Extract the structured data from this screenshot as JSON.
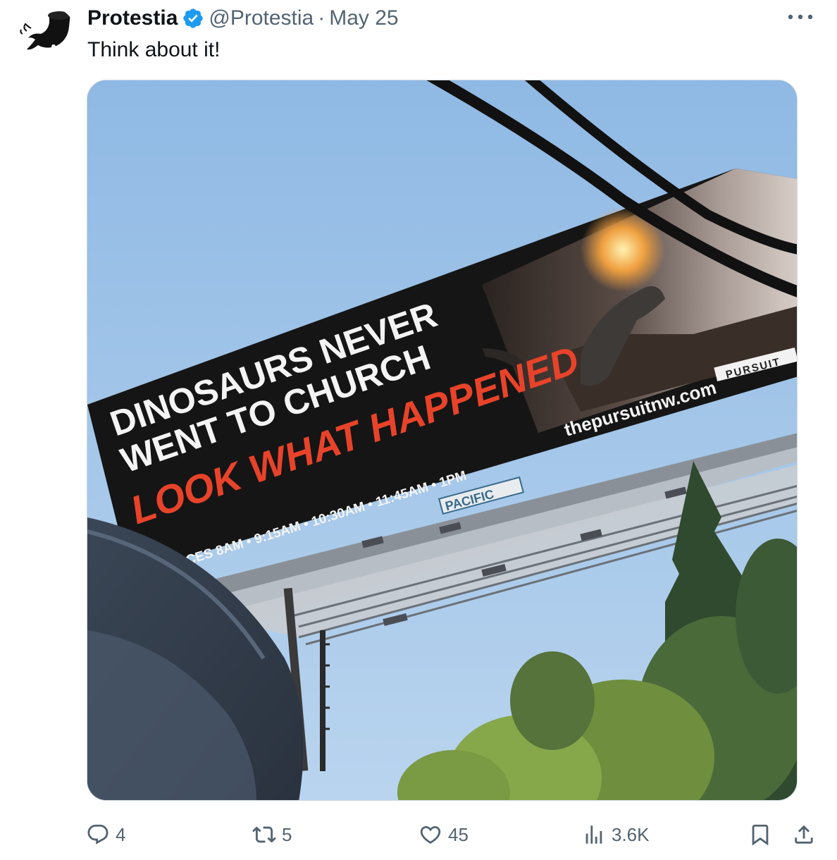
{
  "tweet": {
    "author_name": "Protestia",
    "handle": "@Protestia",
    "separator": "·",
    "date": "May 25",
    "text": "Think about it!",
    "avatar_icon": "protestia-logo-icon",
    "verified_icon": "verified-badge-icon",
    "verified_color": "#1d9bf0"
  },
  "billboard": {
    "line1": "DINOSAURS NEVER",
    "line2": "WENT TO CHURCH",
    "tagline": "LOOK WHAT HAPPENED",
    "services": "ERVICES 8AM • 9:15AM • 10:30AM • 11:45AM • 1PM",
    "url": "thepursuitnw.com",
    "brand": "PURSUIT",
    "operator": "PACIFIC"
  },
  "actions": {
    "reply_count": "4",
    "retweet_count": "5",
    "like_count": "45",
    "views_count": "3.6K"
  },
  "colors": {
    "text_primary": "#0f1419",
    "text_secondary": "#536471",
    "sky": "#9ec3e8",
    "billboard_black": "#151515",
    "tagline_red": "#e8432a"
  }
}
